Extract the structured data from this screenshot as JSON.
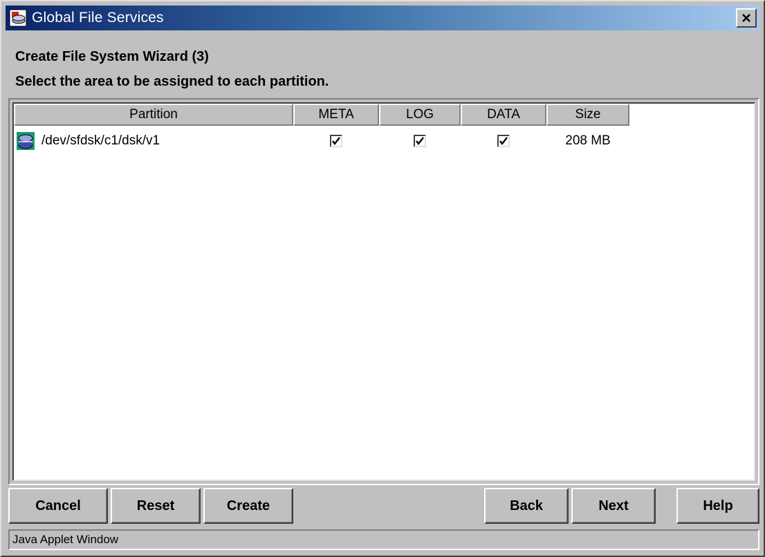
{
  "window": {
    "title": "Global File Services",
    "close_label": "×"
  },
  "heading": {
    "line1": "Create File System Wizard (3)",
    "line2": "Select the area to be assigned to each partition."
  },
  "table": {
    "columns": [
      "Partition",
      "META",
      "LOG",
      "DATA",
      "Size"
    ],
    "rows": [
      {
        "partition": "/dev/sfdsk/c1/dsk/v1",
        "icon": "disk-icon",
        "meta_checked": true,
        "log_checked": true,
        "data_checked": true,
        "size": "208 MB"
      }
    ]
  },
  "buttons": {
    "cancel": "Cancel",
    "reset": "Reset",
    "create": "Create",
    "back": "Back",
    "next": "Next",
    "help": "Help"
  },
  "status": {
    "text": "Java Applet Window"
  },
  "colors": {
    "face": "#c0c0c0",
    "title_start": "#0a246a",
    "title_end": "#a6caf0",
    "icon_green": "#1a9a6a"
  }
}
